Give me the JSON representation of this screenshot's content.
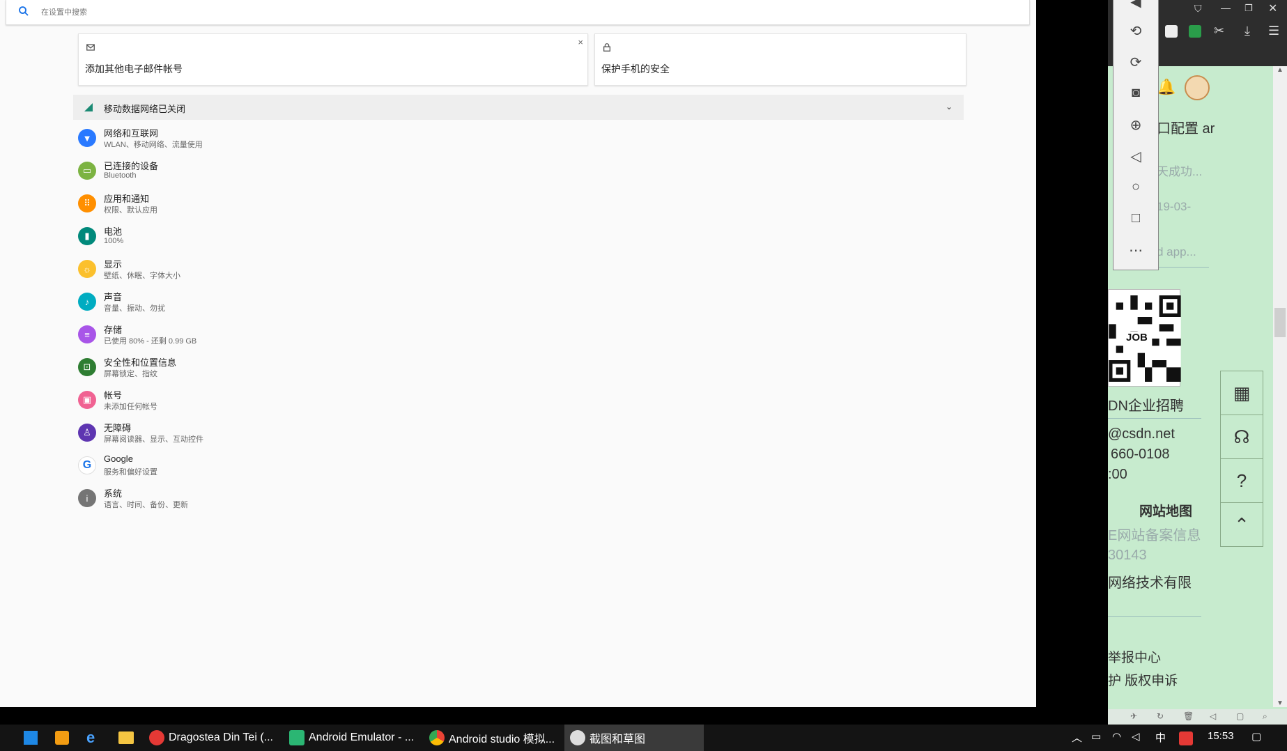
{
  "search": {
    "placeholder": "在设置中搜索"
  },
  "cards": [
    {
      "text": "添加其他电子邮件帐号",
      "close": "×"
    },
    {
      "text": "保护手机的安全"
    }
  ],
  "mobile_bar": {
    "text": "移动数据网络已关闭",
    "chevron": "⌄"
  },
  "settings": [
    {
      "title": "网络和互联网",
      "subtitle": "WLAN、移动网络、流量使用",
      "color": "#2979ff",
      "icon": "wifi-icon"
    },
    {
      "title": "已连接的设备",
      "subtitle": "Bluetooth",
      "color": "#7cb342",
      "icon": "devices-icon"
    },
    {
      "title": "应用和通知",
      "subtitle": "权限、默认应用",
      "color": "#ff8f00",
      "icon": "apps-icon"
    },
    {
      "title": "电池",
      "subtitle": "100%",
      "color": "#00897b",
      "icon": "battery-icon"
    },
    {
      "title": "显示",
      "subtitle": "壁纸、休眠、字体大小",
      "color": "#fbc02d",
      "icon": "display-icon"
    },
    {
      "title": "声音",
      "subtitle": "音量、振动、勿扰",
      "color": "#00acc1",
      "icon": "sound-icon"
    },
    {
      "title": "存储",
      "subtitle": "已使用 80% - 还剩 0.99 GB",
      "color": "#a855e8",
      "icon": "storage-icon"
    },
    {
      "title": "安全性和位置信息",
      "subtitle": "屏幕锁定、指纹",
      "color": "#2e7d32",
      "icon": "lock-icon"
    },
    {
      "title": "帐号",
      "subtitle": "未添加任何帐号",
      "color": "#f06292",
      "icon": "account-icon"
    },
    {
      "title": "无障碍",
      "subtitle": "屏幕阅读器、显示、互动控件",
      "color": "#5e35b1",
      "icon": "accessibility-icon"
    },
    {
      "title": "Google",
      "subtitle": "服务和偏好设置",
      "color": "#1a73e8",
      "icon": "google-icon"
    },
    {
      "title": "系统",
      "subtitle": "语言、时间、备份、更新",
      "color": "#757575",
      "icon": "info-icon"
    }
  ],
  "browser": {
    "snippets": [
      "口配置 ar",
      "天成功...",
      "19-03-",
      "d app...",
      "DN企业招聘",
      "@csdn.net",
      "660-0108",
      ":00",
      "网站地图",
      "E网站备案信息",
      "30143",
      "网络技术有限",
      "举报中心",
      "护  版权申诉"
    ],
    "qr_label": "JOB"
  },
  "taskbar": {
    "apps": [
      "Dragostea Din Tei (...",
      "Android Emulator - ...",
      "Android studio 模拟...",
      "截图和草图"
    ],
    "ime": "中",
    "clock": "15:53"
  }
}
